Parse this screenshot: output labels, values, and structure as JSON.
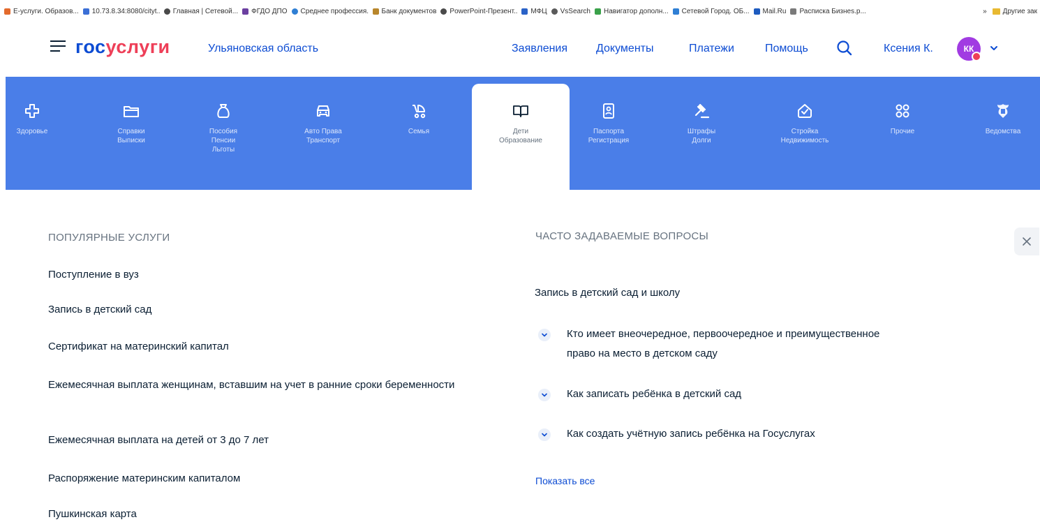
{
  "bookmarks": [
    {
      "label": "Е-услуги. Образов...",
      "color": "#e36a2c"
    },
    {
      "label": "10.73.8.34:8080/cityt...",
      "color": "#3b6fd6"
    },
    {
      "label": "Главная | Сетевой...",
      "color": "#4a4a4a"
    },
    {
      "label": "ФГДО ДПО",
      "color": "#6b3fa0"
    },
    {
      "label": "Среднее профессия...",
      "color": "#2f7fd4"
    },
    {
      "label": "Банк документов",
      "color": "#b8862b"
    },
    {
      "label": "PowerPoint-Презент...",
      "color": "#4a4a4a"
    },
    {
      "label": "МФЦ",
      "color": "#2a62c7"
    },
    {
      "label": "VsSearch",
      "color": "#5a5a5a"
    },
    {
      "label": "Навигатор дополн...",
      "color": "#3aa14a"
    },
    {
      "label": "Сетевой Город. ОБ...",
      "color": "#2f7fd4"
    },
    {
      "label": "Mail.Ru",
      "color": "#1d5bbf"
    },
    {
      "label": "Расписка Бизнеs.р...",
      "color": "#7a7a7a"
    }
  ],
  "bookmarks_more": "»",
  "bookmarks_other": "Другие зак",
  "header": {
    "logo_part1": "гос",
    "logo_part2": "услуги",
    "region": "Ульяновская область",
    "nav": [
      "Заявления",
      "Документы",
      "Платежи",
      "Помощь"
    ],
    "user_name": "Ксения К.",
    "avatar_initials": "КК"
  },
  "categories": [
    {
      "label": "Здоровье",
      "icon": "health-icon"
    },
    {
      "label": "Справки\nВыписки",
      "icon": "folder-icon"
    },
    {
      "label": "Пособия\nПенсии\nЛьготы",
      "icon": "money-bag-icon"
    },
    {
      "label": "Авто Права\nТранспорт",
      "icon": "car-icon"
    },
    {
      "label": "Семья",
      "icon": "stroller-icon"
    },
    {
      "label": "Дети\nОбразование",
      "icon": "book-icon",
      "active": true
    },
    {
      "label": "Паспорта\nРегистрация",
      "icon": "passport-icon"
    },
    {
      "label": "Штрафы\nДолги",
      "icon": "gavel-icon"
    },
    {
      "label": "Стройка\nНедвижимость",
      "icon": "house-icon"
    },
    {
      "label": "Прочие",
      "icon": "grid-icon"
    },
    {
      "label": "Ведомства",
      "icon": "emblem-icon"
    }
  ],
  "popular": {
    "title": "ПОПУЛЯРНЫЕ УСЛУГИ",
    "items": [
      "Поступление в вуз",
      "Запись в детский сад",
      "Сертификат на материнский капитал",
      "Ежемесячная выплата женщинам, вставшим на учет в ранние сроки беременности",
      "Ежемесячная выплата на детей от 3 до 7 лет",
      "Распоряжение материнским капиталом",
      "Пушкинская карта"
    ]
  },
  "faq": {
    "title": "ЧАСТО ЗАДАВАЕМЫЕ ВОПРОСЫ",
    "group": "Запись в детский сад и школу",
    "questions": [
      "Кто имеет внеочередное, первоочередное и преимущественное право на место в детском саду",
      "Как записать ребёнка в детский сад",
      "Как создать учётную запись ребёнка на Госуслугах"
    ],
    "show_all": "Показать все"
  },
  "colors": {
    "brand_blue": "#0d4cd3",
    "brand_red": "#ee3f58",
    "category_bar": "#4a7ee8",
    "avatar": "#a13be2"
  }
}
